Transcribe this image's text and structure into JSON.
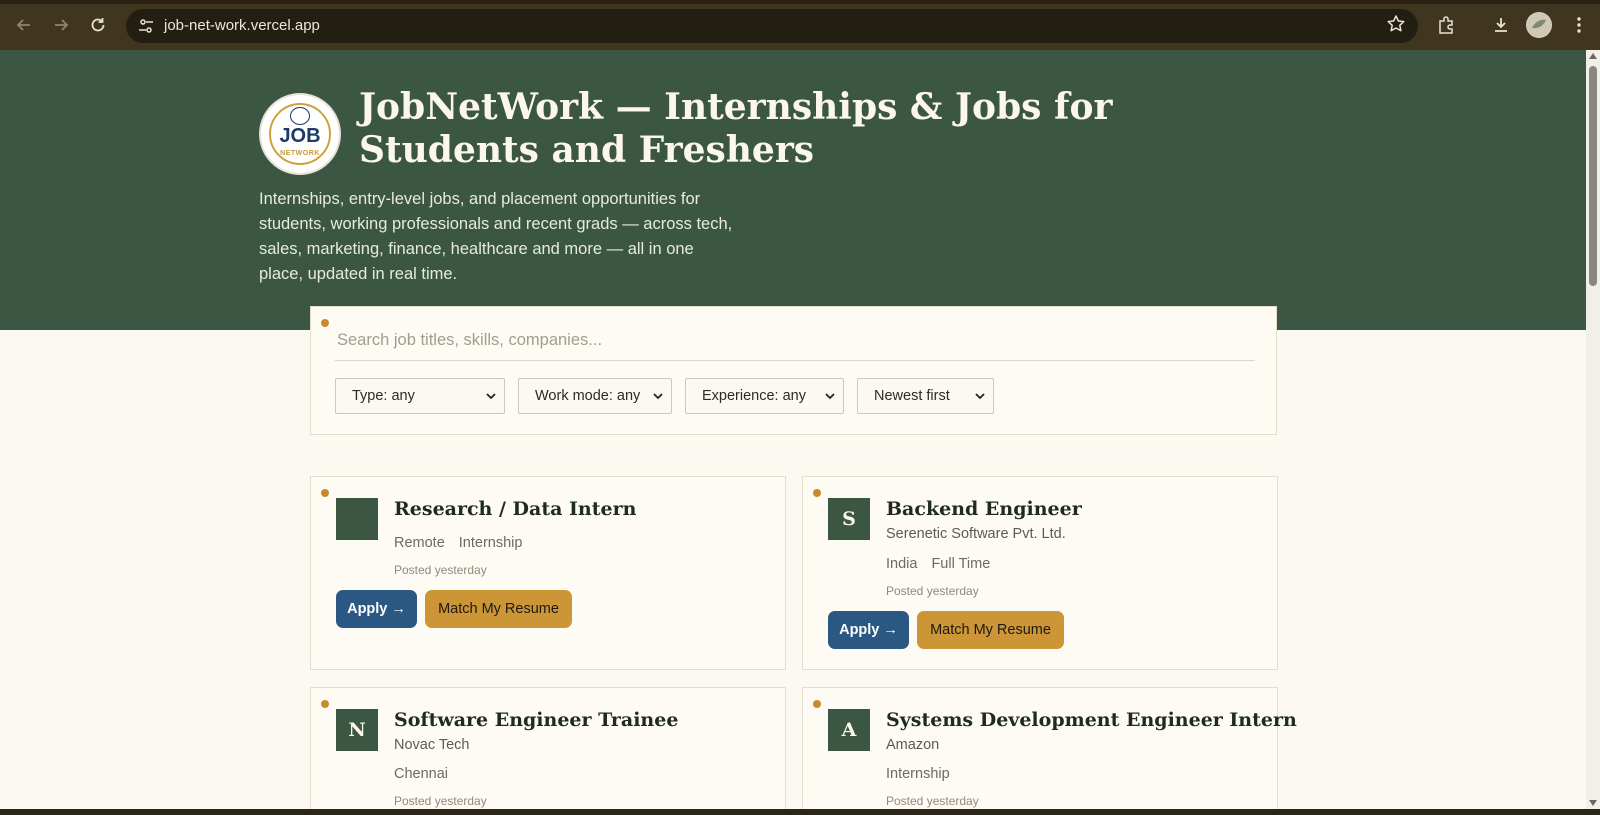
{
  "browser": {
    "url": "job-net-work.vercel.app",
    "icons": [
      "back-arrow-icon",
      "forward-arrow-icon",
      "reload-icon",
      "site-settings-icon",
      "bookmark-star-icon",
      "extensions-icon",
      "download-icon",
      "profile-avatar",
      "more-menu-icon"
    ]
  },
  "hero": {
    "logo_text": "JOB",
    "logo_subtext": "NETWORK",
    "title": "JobNetWork — Internships & Jobs for Students and Freshers",
    "description": "Internships, entry-level jobs, and placement opportunities for students, working professionals and recent grads — across tech, sales, marketing, finance, healthcare and more — all in one place, updated in real time."
  },
  "search": {
    "placeholder": "Search job titles, skills, companies...",
    "filters": {
      "type": "Type: any",
      "work_mode": "Work mode: any",
      "experience": "Experience: any",
      "sort": "Newest first"
    }
  },
  "jobs": [
    {
      "title": "Research / Data Intern",
      "company": "",
      "initial": "",
      "location": "Remote",
      "job_type": "Internship",
      "posted": "Posted yesterday",
      "apply_label": "Apply →",
      "match_label": "Match My Resume"
    },
    {
      "title": "Backend Engineer",
      "company": "Serenetic Software Pvt. Ltd.",
      "initial": "S",
      "location": "India",
      "job_type": "Full Time",
      "posted": "Posted yesterday",
      "apply_label": "Apply →",
      "match_label": "Match My Resume"
    },
    {
      "title": "Software Engineer Trainee",
      "company": "Novac Tech",
      "initial": "N",
      "location": "Chennai",
      "job_type": "",
      "posted": "Posted yesterday"
    },
    {
      "title": "Systems Development Engineer Intern",
      "company": "Amazon",
      "initial": "A",
      "location": "",
      "job_type": "Internship",
      "posted": "Posted yesterday"
    }
  ],
  "colors": {
    "hero_green": "#3c5644",
    "accent_gold": "#cc9536",
    "apply_blue": "#2b5783",
    "page_bg": "#fbf9f1"
  }
}
